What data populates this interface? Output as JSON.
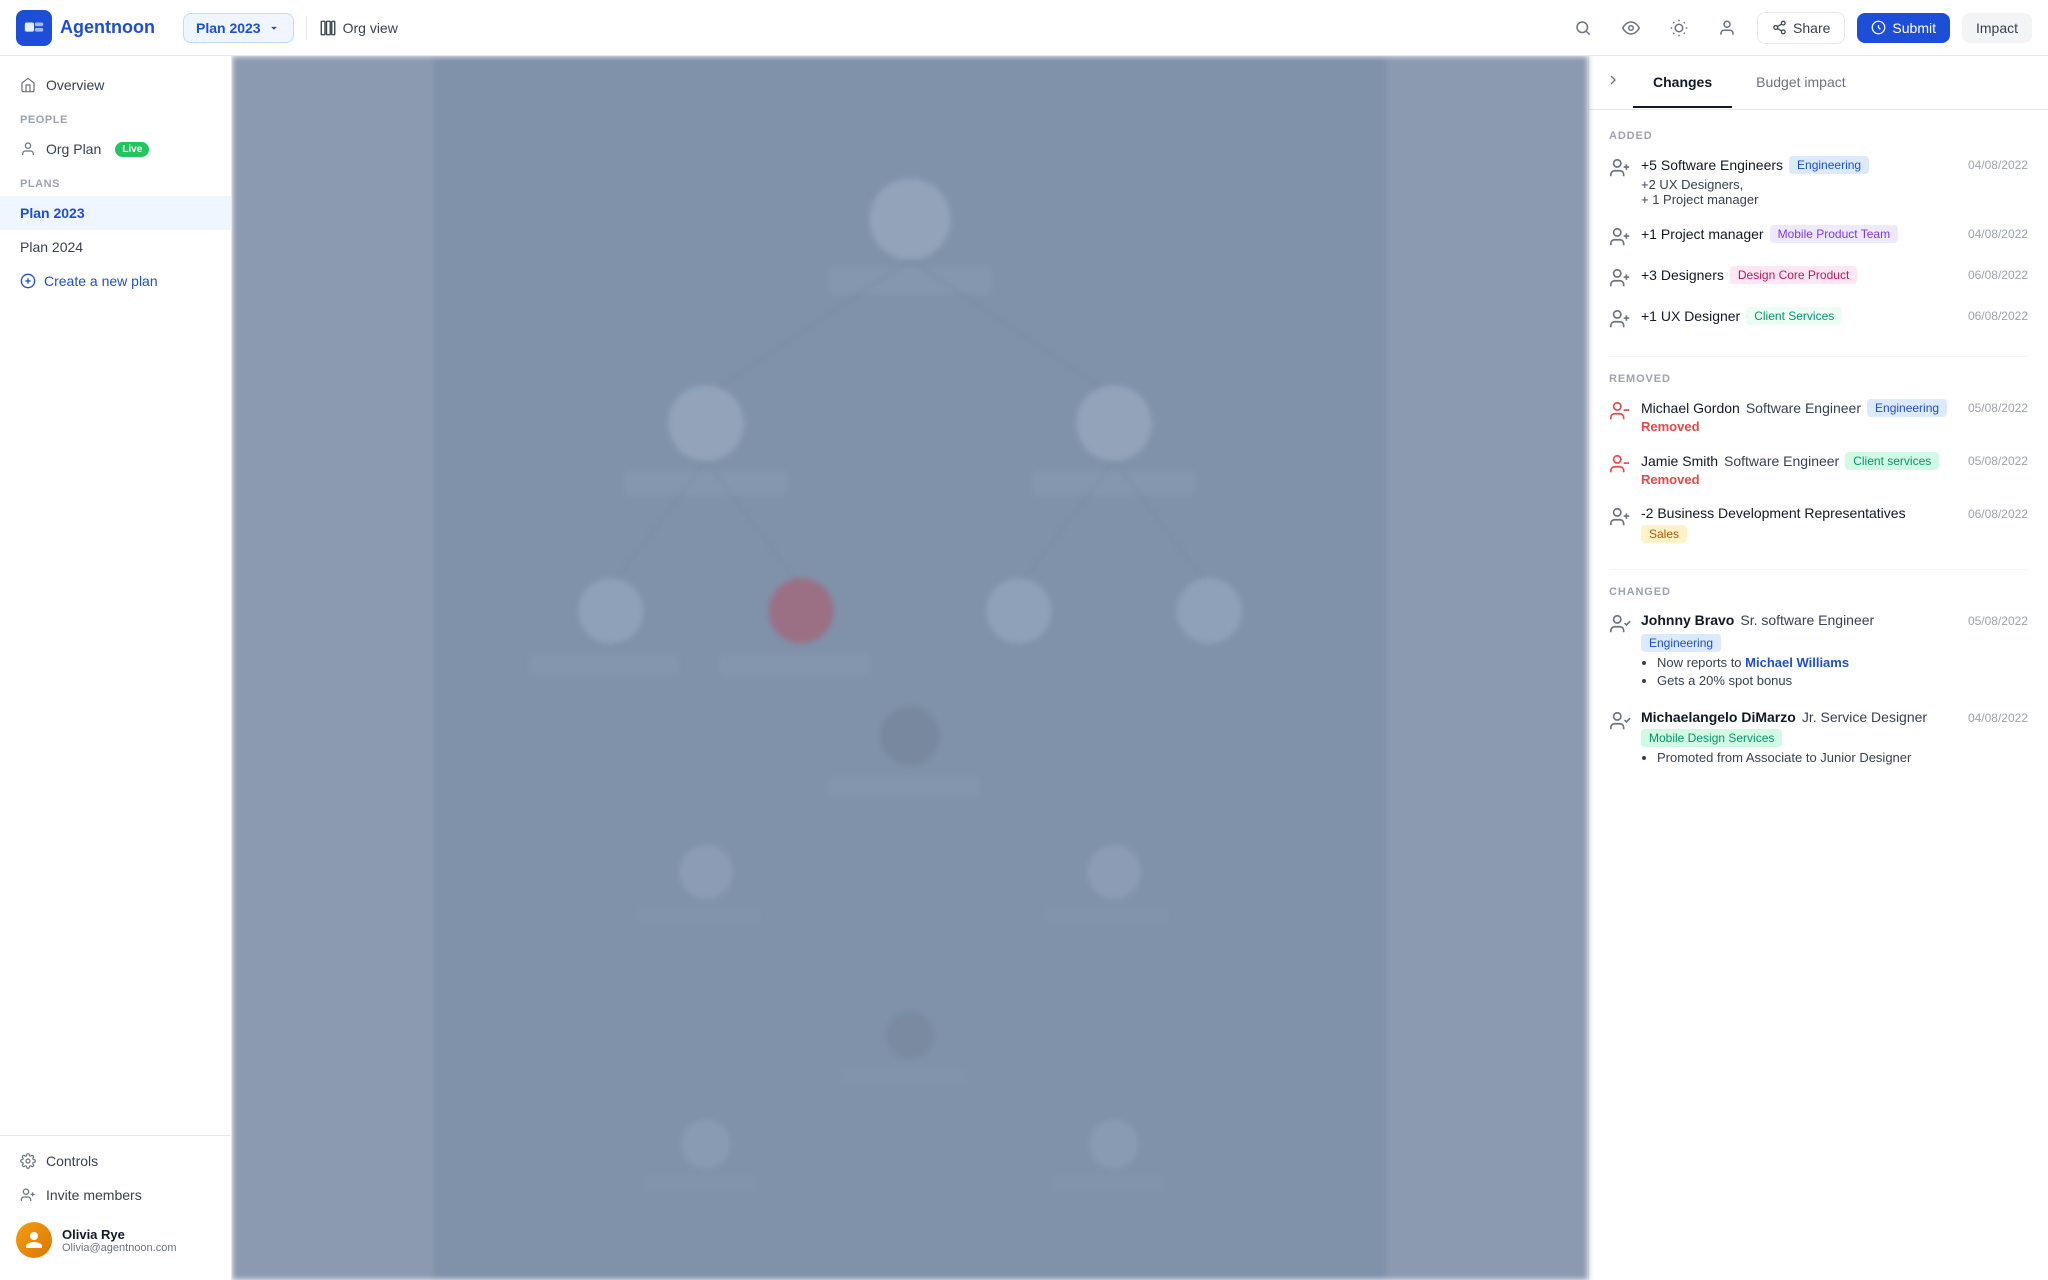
{
  "app": {
    "name": "Agentnoon"
  },
  "topnav": {
    "plan_label": "Plan 2023",
    "org_view_label": "Org view",
    "share_label": "Share",
    "submit_label": "Submit",
    "impact_label": "Impact"
  },
  "sidebar": {
    "overview_label": "Overview",
    "people_section": "PEOPLE",
    "org_plan_label": "Org Plan",
    "live_badge": "Live",
    "plans_section": "PLANS",
    "plan_2023_label": "Plan 2023",
    "plan_2024_label": "Plan 2024",
    "create_plan_label": "Create a new plan",
    "controls_label": "Controls",
    "invite_label": "Invite members",
    "user_name": "Olivia Rye",
    "user_email": "Olivia@agentnoon.com"
  },
  "panel": {
    "tab_changes": "Changes",
    "tab_budget": "Budget impact",
    "sections": {
      "added": "ADDED",
      "removed": "REMOVED",
      "changed": "CHANGED"
    },
    "added_items": [
      {
        "icon": "person-add",
        "title": "+5 Software Engineers",
        "tag": "Engineering",
        "tag_class": "tag-engineering",
        "extra": "+2 UX Designers,\n+ 1 Project manager",
        "date": "04/08/2022"
      },
      {
        "icon": "person-add",
        "title": "+1 Project manager",
        "tag": "Mobile Product Team",
        "tag_class": "tag-mobile",
        "date": "04/08/2022"
      },
      {
        "icon": "person-add",
        "title": "+3 Designers",
        "tag": "Design Core Product",
        "tag_class": "tag-design-core",
        "date": "06/08/2022"
      },
      {
        "icon": "person-add",
        "title": "+1 UX Designer",
        "tag": "Client Services",
        "tag_class": "tag-client",
        "date": "06/08/2022"
      }
    ],
    "removed_items": [
      {
        "icon": "person-remove",
        "person": "Michael Gordon",
        "role": "Software Engineer",
        "tag": "Engineering",
        "tag_class": "tag-engineering",
        "status": "Removed",
        "date": "05/08/2022"
      },
      {
        "icon": "person-remove",
        "person": "Jamie Smith",
        "role": "Software Engineer",
        "tag": "Client services",
        "tag_class": "tag-client-services",
        "status": "Removed",
        "date": "05/08/2022"
      },
      {
        "icon": "person-add",
        "title": "-2 Business Development Representatives",
        "tag": "Sales",
        "tag_class": "tag-sales",
        "date": "06/08/2022"
      }
    ],
    "changed_items": [
      {
        "icon": "person-edit",
        "person": "Johnny Bravo",
        "role": "Sr. software Engineer",
        "tag": "Engineering",
        "tag_class": "tag-engineering",
        "date": "05/08/2022",
        "details": [
          {
            "text": "Now reports to ",
            "link": "Michael Williams",
            "link_only": false
          },
          {
            "text": "Gets a 20% spot bonus",
            "link": null
          }
        ]
      },
      {
        "icon": "person-edit",
        "person": "Michaelangelo DiMarzo",
        "role": "Jr. Service Designer",
        "tag": "Mobile Design Services",
        "tag_class": "tag-mobile-design",
        "date": "04/08/2022",
        "details": [
          {
            "text": "Promoted from Associate to Junior Designer",
            "link": null
          }
        ]
      }
    ]
  }
}
